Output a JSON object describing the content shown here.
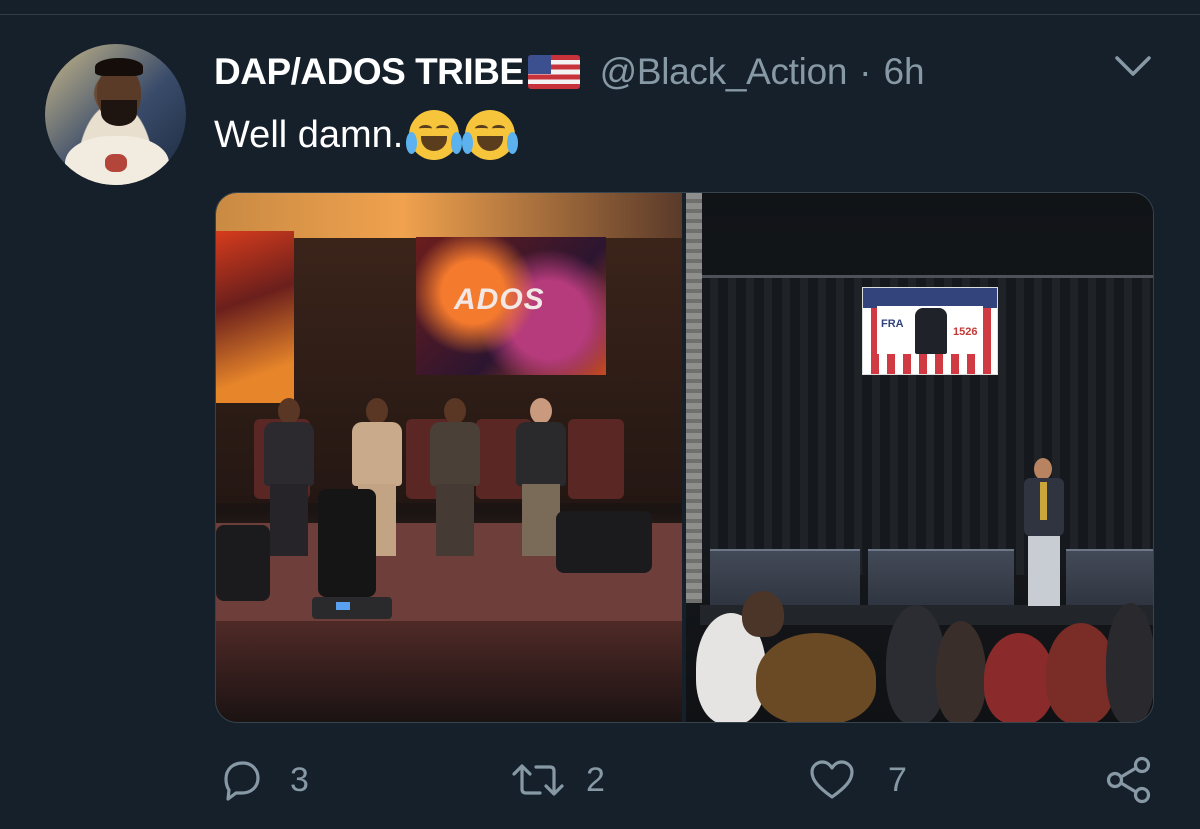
{
  "tweet": {
    "display_name": "DAP/ADOS TRIBE",
    "flag_emoji": "us-flag-emoji",
    "handle": "@Black_Action",
    "separator": "·",
    "time": "6h",
    "text": "Well damn.",
    "emojis": [
      "face-with-tears-of-joy",
      "loudly-crying-face"
    ]
  },
  "media": {
    "left_photo": {
      "screen_text": "ADOS",
      "description_icon": "conference-panel-photo"
    },
    "right_photo": {
      "banner_left_text": "FRA",
      "banner_right_text": "1526",
      "description_icon": "speaker-stage-photo"
    }
  },
  "actions": {
    "reply_count": "3",
    "retweet_count": "2",
    "like_count": "7"
  },
  "colors": {
    "background": "#15202b",
    "secondary_text": "#8899a6",
    "primary_text": "#ffffff"
  }
}
